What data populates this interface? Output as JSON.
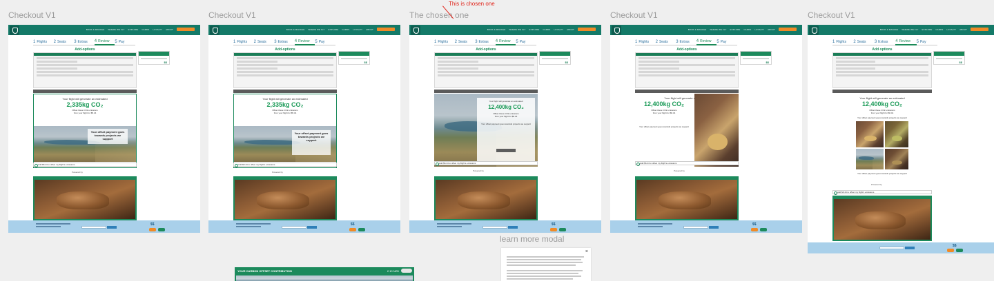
{
  "frames": [
    {
      "label": "Checkout V1"
    },
    {
      "label": "Checkout V1"
    },
    {
      "label": "The chosen one"
    },
    {
      "label": "Checkout V1"
    },
    {
      "label": "Checkout V1"
    }
  ],
  "annotation": "This is chosen one",
  "modal_label": "learn more modal",
  "modal_close": "×",
  "nav": [
    "BOOK & MANAGE",
    "WHERE WE FLY",
    "EXPLORE",
    "CARDS",
    "LOYALTY",
    "ABOUT"
  ],
  "fly_button": "FLY WITH US",
  "steps": [
    {
      "num": "1",
      "label": "Flights"
    },
    {
      "num": "2",
      "label": "Seats"
    },
    {
      "num": "3",
      "label": "Extras"
    },
    {
      "num": "4",
      "label": "Review"
    },
    {
      "num": "5",
      "label": "Pay"
    }
  ],
  "page_heading_a": "Add-options",
  "page_heading_b": "Add options",
  "side_price": "$$",
  "offset_a": {
    "line1": "Your flight will generate an estimated",
    "amount": "2,335kg CO₂",
    "line2": "Offset these CO2 emissions",
    "line3": "from your flight for $5.44",
    "caption": "Your offset payment goes towards projects we support",
    "check": "Add $5.44 to offset my flight's emissions",
    "powered": "Powered by"
  },
  "offset_b": {
    "line1": "Your flight will generate an estimated",
    "amount": "12,400kg CO₂",
    "line2": "Offset these CO2 emissions",
    "line3": "from your flight for $6.44",
    "caption": "Your offset payment goes towards projects we support",
    "check": "Add $6.44 to offset my flight's emissions",
    "powered": "Powered by"
  },
  "contrib": {
    "title": "YOUR CARBON OFFSET CONTRIBUTION",
    "value": "2.10 NZD"
  },
  "colors": {
    "brand": "#147a68",
    "accent_green": "#1a9a57",
    "orange": "#f08a26",
    "footer": "#a9d0ea",
    "annotation": "#e0241a"
  }
}
